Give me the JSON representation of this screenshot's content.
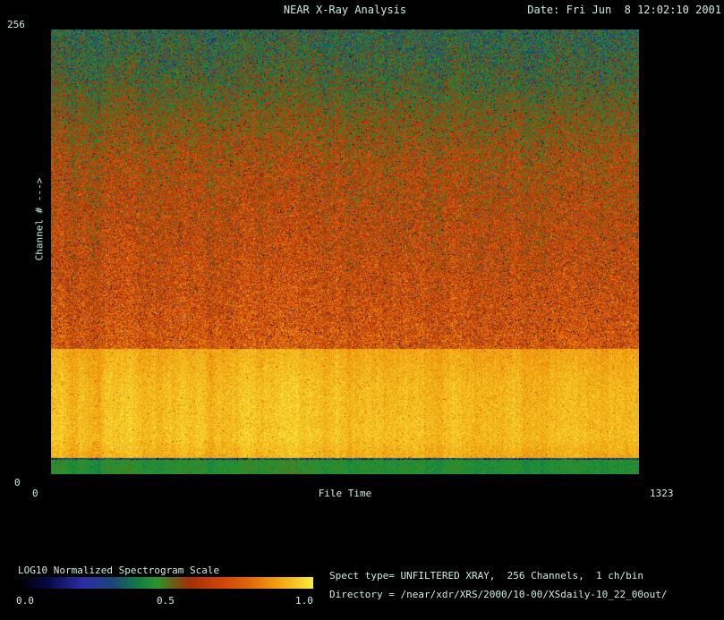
{
  "header": {
    "title": "NEAR X-Ray Analysis",
    "date": "Date: Fri Jun  8 12:02:10 2001"
  },
  "plot": {
    "y_axis_label": "Channel # --->",
    "y_tick_max": "256",
    "y_tick_min": "0",
    "x_axis_label": "File Time",
    "x_tick_min": "0",
    "x_tick_max": "1323"
  },
  "colorbar": {
    "label": "LOG10 Normalized Spectrogram Scale",
    "ticks": [
      "0.0",
      "0.5",
      "1.0"
    ]
  },
  "info": {
    "spect_type_line": "Spect type= UNFILTERED XRAY,  256 Channels,  1 ch/bin",
    "directory_line": "Directory = /near/xdr/XRS/2000/10-00/XSdaily-10_22_00out/"
  },
  "chart_data": {
    "type": "heatmap",
    "title": "NEAR X-Ray Analysis",
    "xlabel": "File Time",
    "ylabel": "Channel # --->",
    "xlim": [
      0,
      1323
    ],
    "ylim": [
      0,
      256
    ],
    "grid": false,
    "colorbar_label": "LOG10 Normalized Spectrogram Scale",
    "colorbar_range": [
      0.0,
      1.0
    ],
    "colorbar_position": "bottom-left",
    "description": "Log10-normalized X-ray spectrogram: channels ~9-72 form a bright yellow-orange high-intensity band, channels 72-256 fade from red-orange up to noisy green, a uniform green quiet strip covers channels 0-8, with speckle noise and scattered dark-blue pixels throughout.",
    "color_stops": [
      [
        0.0,
        [
          0,
          0,
          0
        ]
      ],
      [
        0.1,
        [
          8,
          8,
          70
        ]
      ],
      [
        0.22,
        [
          45,
          45,
          165
        ]
      ],
      [
        0.32,
        [
          25,
          70,
          120
        ]
      ],
      [
        0.4,
        [
          18,
          120,
          70
        ]
      ],
      [
        0.47,
        [
          40,
          150,
          45
        ]
      ],
      [
        0.53,
        [
          110,
          90,
          20
        ]
      ],
      [
        0.58,
        [
          160,
          50,
          10
        ]
      ],
      [
        0.68,
        [
          205,
          65,
          10
        ]
      ],
      [
        0.78,
        [
          225,
          100,
          10
        ]
      ],
      [
        0.88,
        [
          240,
          160,
          15
        ]
      ],
      [
        1.0,
        [
          250,
          235,
          60
        ]
      ]
    ],
    "bands": [
      {
        "name": "quiet-bottom-strip",
        "range": [
          0,
          8
        ],
        "profile": [
          [
            0,
            0.46
          ],
          [
            8,
            0.46
          ]
        ],
        "noise": 0.03,
        "dark_prob": 0.012,
        "dark_range": [
          0.28,
          0.4
        ]
      },
      {
        "name": "separator-line",
        "range": [
          8,
          9
        ],
        "profile": [
          [
            8,
            0.35
          ],
          [
            9,
            0.35
          ]
        ],
        "noise": 0.1,
        "dark_prob": 0.3,
        "dark_range": [
          0.0,
          0.3
        ]
      },
      {
        "name": "intense-low-channels",
        "range": [
          9,
          72
        ],
        "profile": [
          [
            9,
            0.9
          ],
          [
            20,
            0.93
          ],
          [
            50,
            0.92
          ],
          [
            72,
            0.89
          ]
        ],
        "noise": 0.05,
        "dark_prob": 0.006,
        "dark_range": [
          0.55,
          0.8
        ]
      },
      {
        "name": "upper-channels-gradient",
        "range": [
          72,
          256
        ],
        "profile": [
          [
            72,
            0.73
          ],
          [
            100,
            0.7
          ],
          [
            140,
            0.66
          ],
          [
            180,
            0.62
          ],
          [
            205,
            0.55
          ],
          [
            225,
            0.48
          ],
          [
            256,
            0.42
          ]
        ],
        "noise": 0.16,
        "dark_prob": 0.022,
        "dark_range": [
          0.0,
          0.32
        ]
      }
    ]
  }
}
